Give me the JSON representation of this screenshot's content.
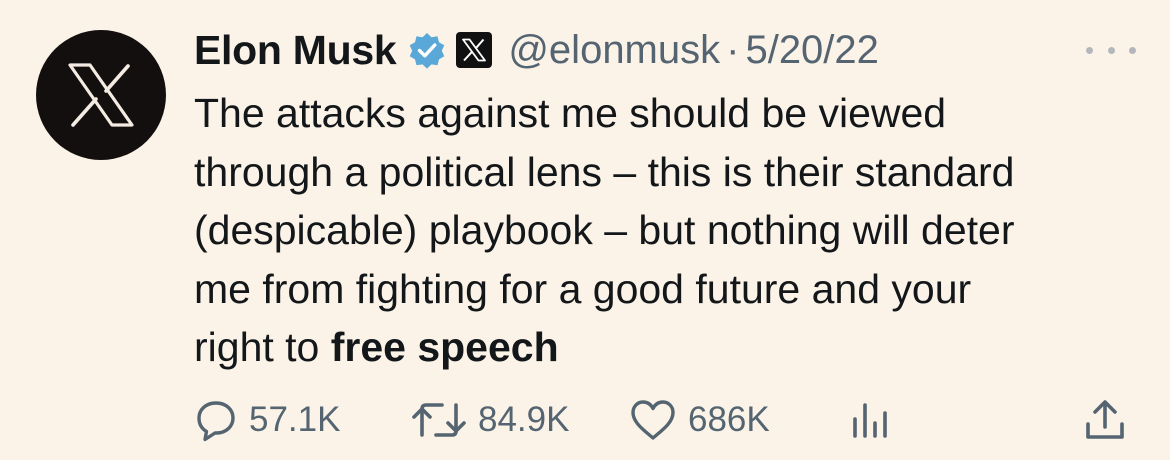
{
  "author": {
    "display_name": "Elon Musk",
    "handle": "@elonmusk",
    "separator": "·",
    "date": "5/20/22",
    "avatar_icon": "x-logo-icon",
    "verified_icon": "verified-badge-icon",
    "affiliate_icon": "x-affiliate-badge-icon"
  },
  "tweet": {
    "lines": [
      "The attacks against me should be viewed",
      "through a political lens – this is their standard",
      "(despicable) playbook – but nothing will deter",
      "me from fighting for a good future and your"
    ],
    "last_line_prefix": "right to ",
    "last_line_bold": "free speech"
  },
  "actions": {
    "replies": "57.1K",
    "retweets": "84.9K",
    "likes": "686K"
  },
  "colors": {
    "background": "#fbf3e8",
    "text": "#14171a",
    "secondary": "#546471",
    "verified": "#5aa8d8"
  }
}
